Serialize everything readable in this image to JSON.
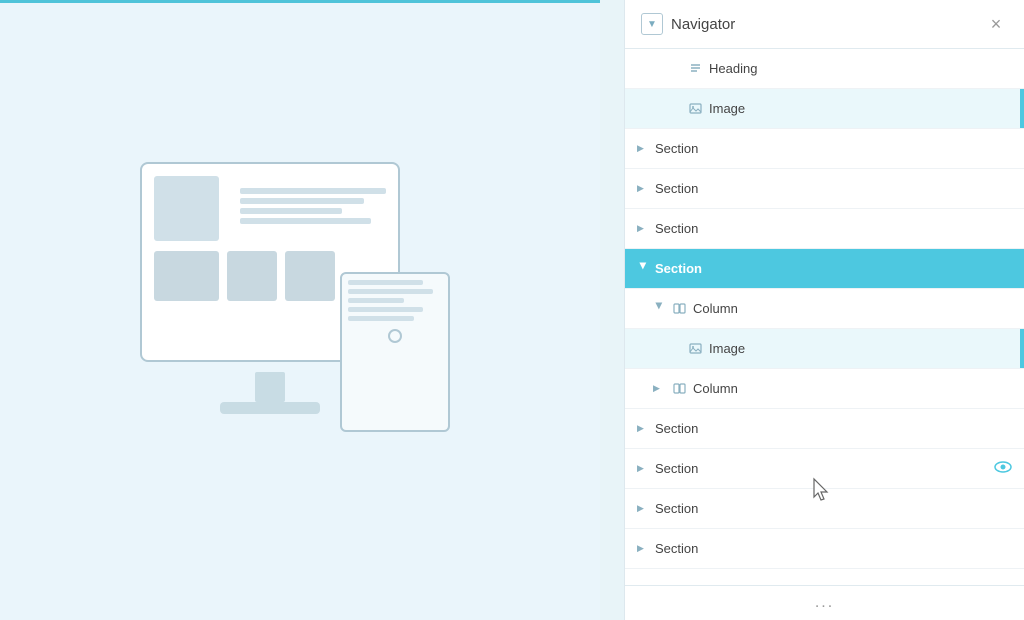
{
  "panel": {
    "title": "Navigator",
    "close_label": "×",
    "collapse_icon": "▼",
    "footer_dots": "...",
    "colors": {
      "active_bg": "#4dc8e0",
      "accent_bar": "#4dc8e0",
      "eye_color": "#4dc8e0"
    }
  },
  "tree_items": [
    {
      "id": "heading",
      "label": "Heading",
      "icon": "text",
      "indent": 2,
      "chevron": "",
      "state": "leaf"
    },
    {
      "id": "image-top",
      "label": "Image",
      "icon": "image",
      "indent": 2,
      "chevron": "",
      "state": "leaf",
      "highlighted": true
    },
    {
      "id": "section-1",
      "label": "Section",
      "icon": "",
      "indent": 0,
      "chevron": "right",
      "state": "collapsed"
    },
    {
      "id": "section-2",
      "label": "Section",
      "icon": "",
      "indent": 0,
      "chevron": "right",
      "state": "collapsed"
    },
    {
      "id": "section-3",
      "label": "Section",
      "icon": "",
      "indent": 0,
      "chevron": "right",
      "state": "collapsed"
    },
    {
      "id": "section-active",
      "label": "Section",
      "icon": "",
      "indent": 0,
      "chevron": "down",
      "state": "active"
    },
    {
      "id": "column-1",
      "label": "Column",
      "icon": "column",
      "indent": 1,
      "chevron": "down",
      "state": "expanded"
    },
    {
      "id": "image-nested",
      "label": "Image",
      "icon": "image",
      "indent": 2,
      "chevron": "",
      "state": "leaf",
      "highlighted": true
    },
    {
      "id": "column-2",
      "label": "Column",
      "icon": "column",
      "indent": 1,
      "chevron": "right",
      "state": "collapsed"
    },
    {
      "id": "section-4",
      "label": "Section",
      "icon": "",
      "indent": 0,
      "chevron": "right",
      "state": "collapsed"
    },
    {
      "id": "section-5",
      "label": "Section",
      "icon": "",
      "indent": 0,
      "chevron": "right",
      "state": "collapsed",
      "eye": true
    },
    {
      "id": "section-6",
      "label": "Section",
      "icon": "",
      "indent": 0,
      "chevron": "right",
      "state": "collapsed"
    },
    {
      "id": "section-7",
      "label": "Section",
      "icon": "",
      "indent": 0,
      "chevron": "right",
      "state": "collapsed"
    }
  ]
}
